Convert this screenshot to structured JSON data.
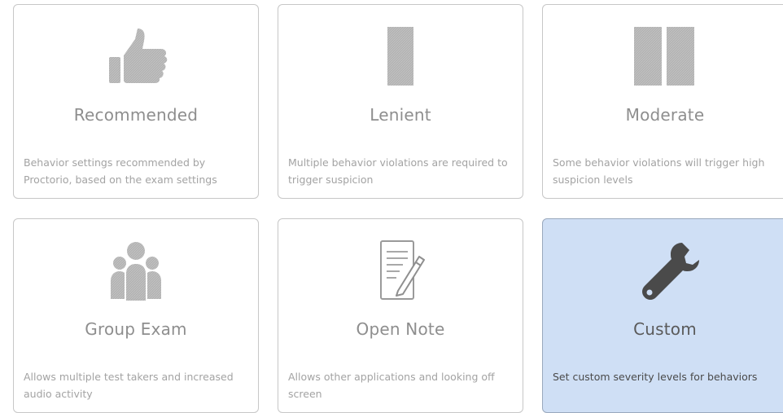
{
  "cards": [
    {
      "title": "Recommended",
      "description": "Behavior settings recommended by Proctorio, based on the exam settings",
      "icon": "thumbs-up-icon",
      "selected": false
    },
    {
      "title": "Lenient",
      "description": "Multiple behavior violations are required to trigger suspicion",
      "icon": "single-bar-icon",
      "selected": false
    },
    {
      "title": "Moderate",
      "description": "Some behavior violations will trigger high suspicion levels",
      "icon": "double-bar-icon",
      "selected": false
    },
    {
      "title": "Group Exam",
      "description": "Allows multiple test takers and increased audio activity",
      "icon": "group-icon",
      "selected": false
    },
    {
      "title": "Open Note",
      "description": "Allows other applications and looking off screen",
      "icon": "note-pencil-icon",
      "selected": false
    },
    {
      "title": "Custom",
      "description": "Set custom severity levels for behaviors",
      "icon": "wrench-icon",
      "selected": true
    }
  ],
  "colors": {
    "icon_gray": "#b5b5b5",
    "selected_bg": "#cfdff5",
    "selected_icon": "#4a4a4a"
  }
}
